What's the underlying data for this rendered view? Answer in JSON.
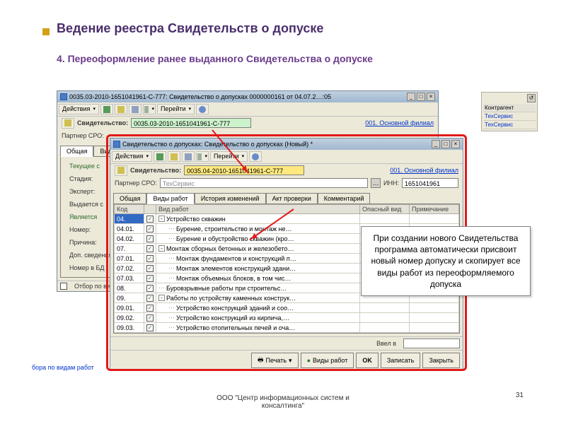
{
  "slide": {
    "title": "Ведение реестра Свидетельств о допуске",
    "subtitle": "4. Переоформление ранее выданного Свидетельства о допуске",
    "footer_org": "ООО \"Центр информационных систем и консалтинга\"",
    "page_num": "31"
  },
  "callout": "При создании нового Свидетельства программа автоматически присвоит новый номер допуску и скопирует все виды работ из переоформляемого допуска",
  "side_panel": {
    "h1": "Контрагент",
    "r1": "ТехСервис",
    "r2": "ТехСервис"
  },
  "back_win": {
    "title": "0035.03-2010-1651041961-С-777: Свидетельство о допусках 0000000161 от 04.07.2…:05",
    "actions": "Действия",
    "goto": "Перейти",
    "lbl_cert": "Свидетельство:",
    "cert_val": "0035.03-2010-1651041961-С-777",
    "branch": "001. Основной филиал",
    "lbl_partner": "Партнер СРО:",
    "tabs": [
      "Общая",
      "Виды"
    ],
    "grp_cur": "Текущее с",
    "lbl_stage": "Стадия:",
    "lbl_expert": "Эксперт:",
    "lbl_issued": "Выдается с",
    "grp_iss": "Является",
    "lbl_num": "Номер:",
    "lbl_reason": "Причина:",
    "lbl_extra": "Доп. сведения",
    "lbl_bdnum": "Номер в БД",
    "filter": "Отбор по видам",
    "filter_hint": "бора по видам работ"
  },
  "front_win": {
    "title": "Свидетельство о допусках: Свидетельство о допусках (Новый) *",
    "actions": "Действия",
    "goto": "Перейти",
    "lbl_cert": "Свидетельство:",
    "cert_val": "0035.04-2010-1651041961-С-777",
    "branch": "001. Основной филиал",
    "lbl_partner": "Партнер СРО:",
    "partner_val": "ТехСервис",
    "lbl_inn": "ИНН:",
    "inn_val": "1651041961",
    "tabs": [
      "Общая",
      "Виды работ",
      "История изменений",
      "Акт проверки",
      "Комментарий"
    ],
    "cols": [
      "Код",
      "Вид работ",
      "Опасный вид",
      "Примечание"
    ],
    "rows": [
      {
        "k": "04.",
        "v": "Устройство скважин",
        "p": "-",
        "pm": "-",
        "lvl": 0
      },
      {
        "k": "04.01.",
        "v": "Бурение, строительство и монтаж не…",
        "p": "",
        "pm": "",
        "lvl": 1
      },
      {
        "k": "04.02.",
        "v": "Бурение и обустройство скважин (кро…",
        "p": "",
        "pm": "",
        "lvl": 1
      },
      {
        "k": "07.",
        "v": "Монтаж сборных бетонных и железобето…",
        "p": "-",
        "pm": "-",
        "lvl": 0
      },
      {
        "k": "07.01.",
        "v": "Монтаж фундаментов и конструкций п…",
        "p": "",
        "pm": "",
        "lvl": 1
      },
      {
        "k": "07.02.",
        "v": "Монтаж элементов конструкций здани…",
        "p": "",
        "pm": "",
        "lvl": 1
      },
      {
        "k": "07.03.",
        "v": "Монтаж объемных блоков, в том чис…",
        "p": "",
        "pm": "",
        "lvl": 1
      },
      {
        "k": "08.",
        "v": "Буровзрывные работы при строительс…",
        "p": "",
        "pm": "",
        "lvl": 0
      },
      {
        "k": "09.",
        "v": "Работы по устройству каменных конструк…",
        "p": "-",
        "pm": "-",
        "lvl": 0
      },
      {
        "k": "09.01.",
        "v": "Устройство конструкций зданий и соо…",
        "p": "",
        "pm": "",
        "lvl": 1
      },
      {
        "k": "09.02.",
        "v": "Устройство конструкций из кирпича,…",
        "p": "",
        "pm": "",
        "lvl": 1
      },
      {
        "k": "09.03.",
        "v": "Устройство отопительных печей и оча…",
        "p": "",
        "pm": "",
        "lvl": 1
      }
    ],
    "entered": "Ввел в",
    "btn_print": "Печать",
    "btn_works": "Виды работ",
    "btn_ok": "OK",
    "btn_save": "Записать",
    "btn_close": "Закрыть"
  }
}
